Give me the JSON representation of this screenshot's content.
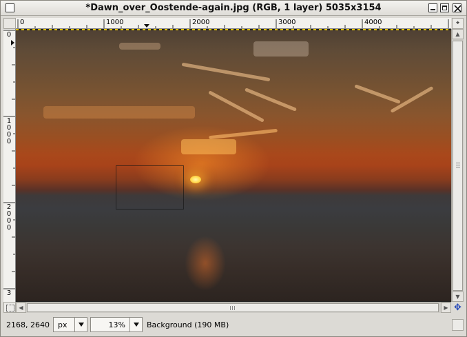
{
  "window": {
    "title": "*Dawn_over_Oostende-again.jpg (RGB, 1 layer) 5035x3154",
    "buttons": [
      "window-menu",
      "minimize",
      "maximize",
      "close"
    ]
  },
  "rulers": {
    "top_labels": [
      "0",
      "1000",
      "2000",
      "3000",
      "4000"
    ],
    "left_labels": [
      "0",
      "1000",
      "2000",
      "3"
    ]
  },
  "statusbar": {
    "coords": "2168, 2640",
    "unit": "px",
    "zoom": "13%",
    "message": "Background (190 MB)"
  },
  "icons": {
    "navigate": "navigate-icon",
    "quick_mask": "quick-mask-icon",
    "nav_cross": "move-cross-icon"
  },
  "colors": {
    "sun": "#ffd84a",
    "sky_orange": "#a9481b",
    "selection_border": "#141414"
  }
}
